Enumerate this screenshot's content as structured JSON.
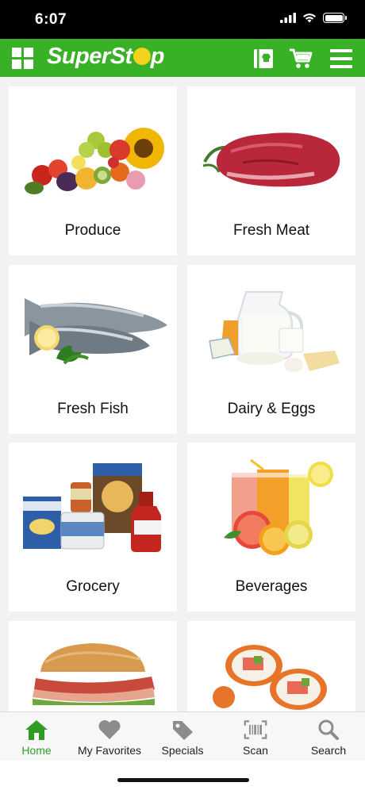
{
  "status_bar": {
    "time": "6:07"
  },
  "header": {
    "logo_text_1": "Super",
    "logo_text_2": "St",
    "logo_text_3": "p",
    "accent": "#39b126",
    "logo_accent": "#f3d21c"
  },
  "categories": [
    {
      "label": "Produce",
      "image": "produce-image"
    },
    {
      "label": "Fresh Meat",
      "image": "meat-image"
    },
    {
      "label": "Fresh Fish",
      "image": "fish-image"
    },
    {
      "label": "Dairy & Eggs",
      "image": "dairy-image"
    },
    {
      "label": "Grocery",
      "image": "grocery-image"
    },
    {
      "label": "Beverages",
      "image": "beverages-image"
    },
    {
      "label": "",
      "image": "sandwich-image"
    },
    {
      "label": "",
      "image": "sushi-image"
    }
  ],
  "tabs": [
    {
      "label": "Home",
      "icon": "home-icon",
      "active": true
    },
    {
      "label": "My Favorites",
      "icon": "heart-icon",
      "active": false
    },
    {
      "label": "Specials",
      "icon": "tag-icon",
      "active": false
    },
    {
      "label": "Scan",
      "icon": "barcode-icon",
      "active": false
    },
    {
      "label": "Search",
      "icon": "search-icon",
      "active": false
    }
  ]
}
